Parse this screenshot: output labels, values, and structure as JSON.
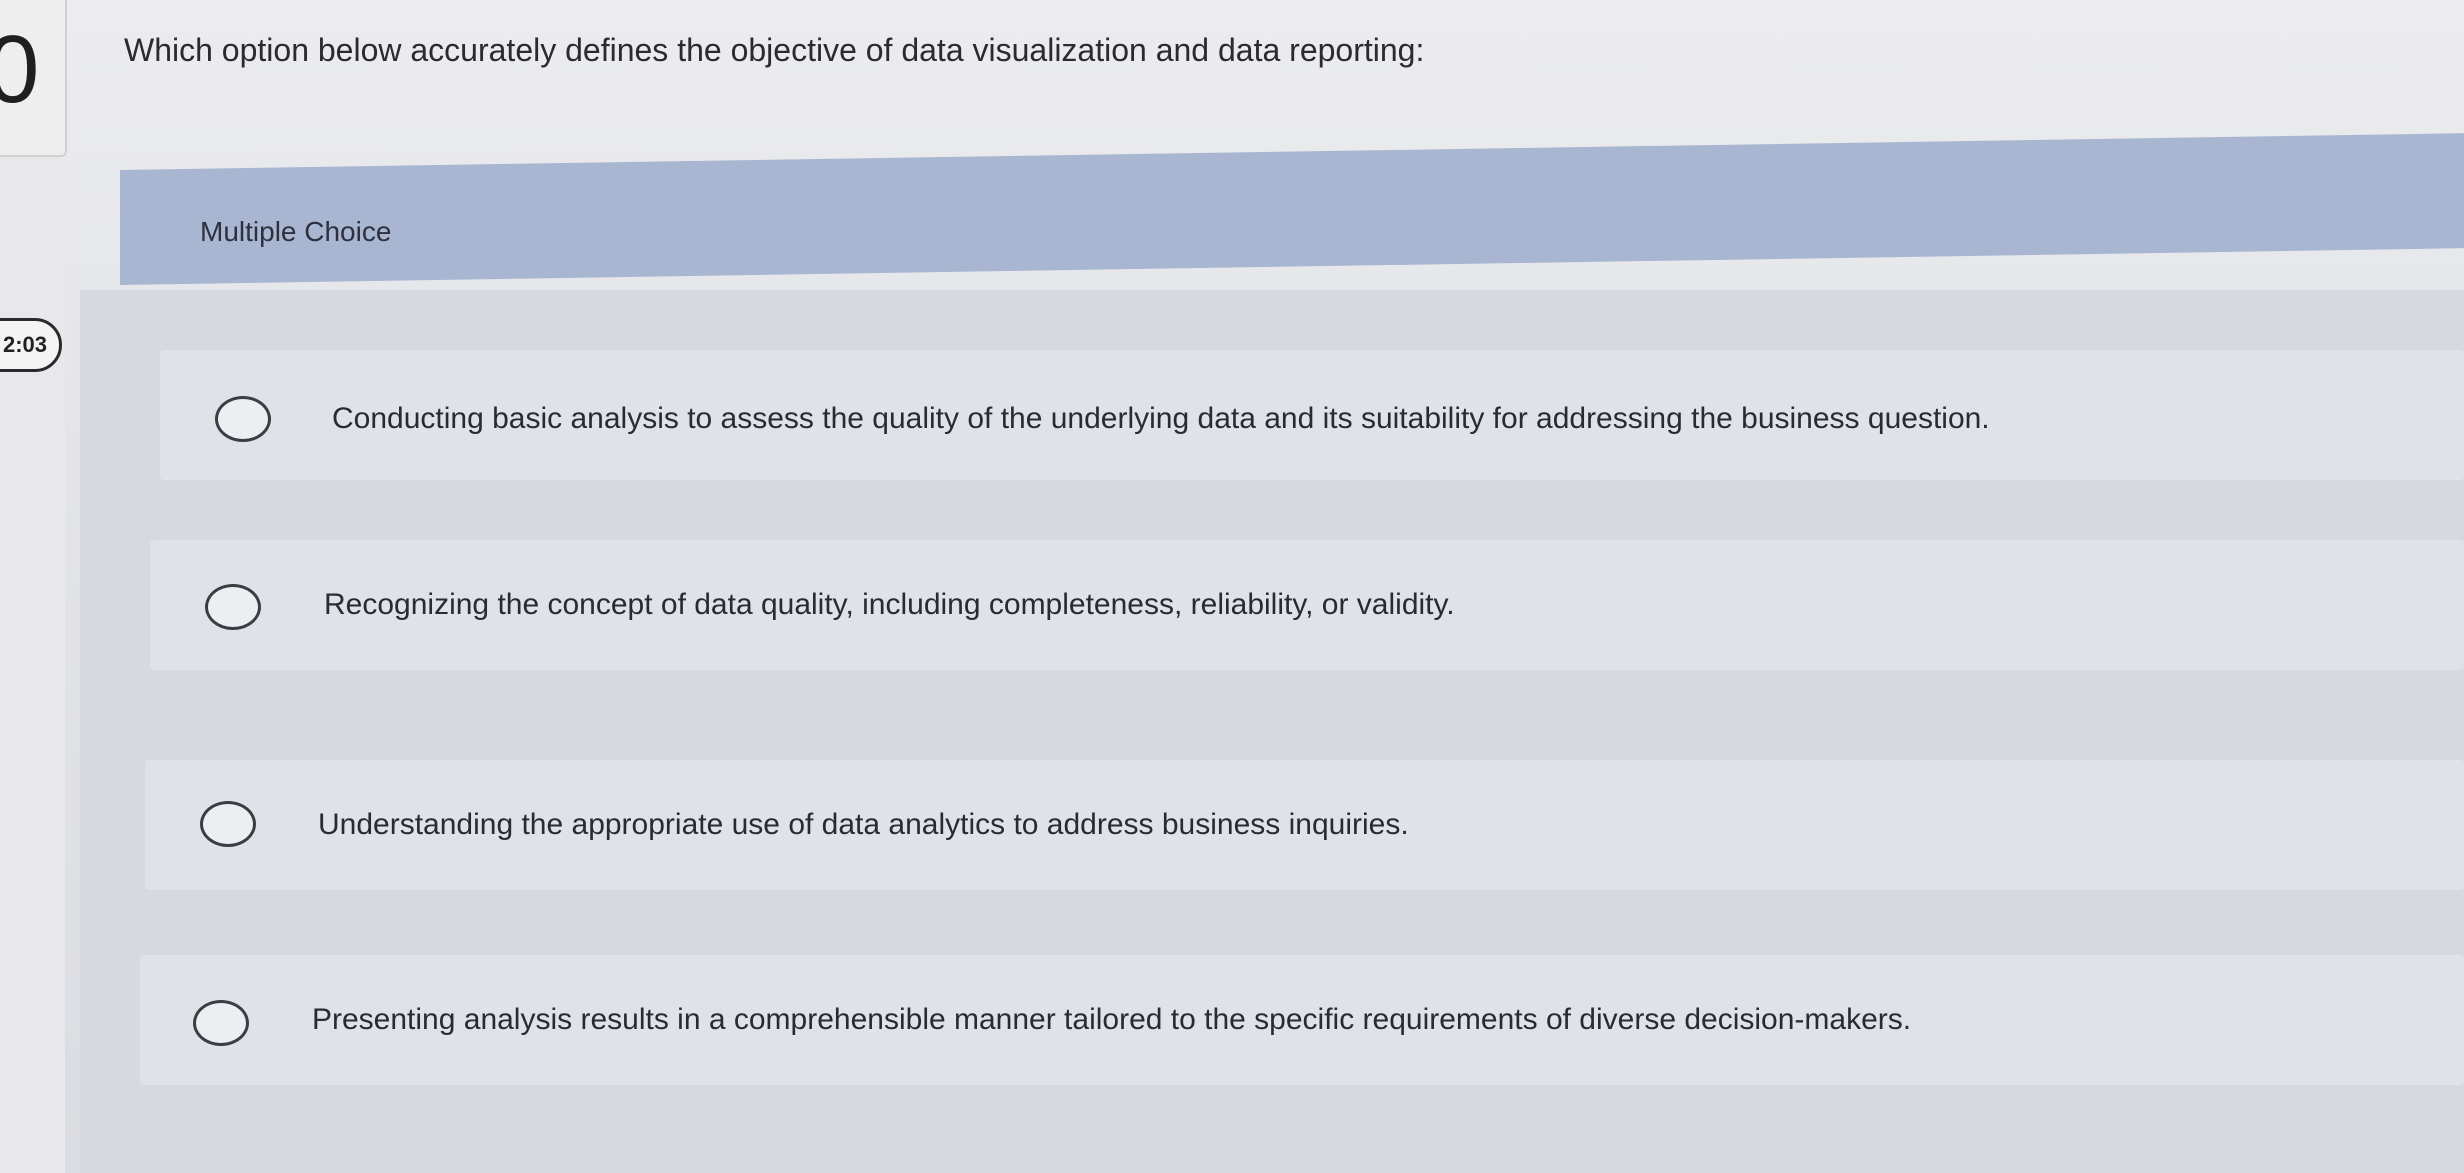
{
  "question": {
    "number": "0",
    "timer": "2:03",
    "prompt": "Which option below accurately defines the objective of data visualization and data reporting:"
  },
  "section": {
    "label": "Multiple Choice"
  },
  "options": [
    {
      "text": "Conducting basic analysis to assess the quality of the underlying data and its suitability for addressing the business question."
    },
    {
      "text": "Recognizing the concept of data quality, including completeness, reliability, or validity."
    },
    {
      "text": "Understanding the appropriate use of data analytics to address business inquiries."
    },
    {
      "text": "Presenting analysis results in a comprehensible manner tailored to the specific requirements of diverse decision-makers."
    }
  ],
  "colors": {
    "header_band": "#a9b6d2",
    "background": "#e4e6ea",
    "text": "#2a2a2e"
  }
}
